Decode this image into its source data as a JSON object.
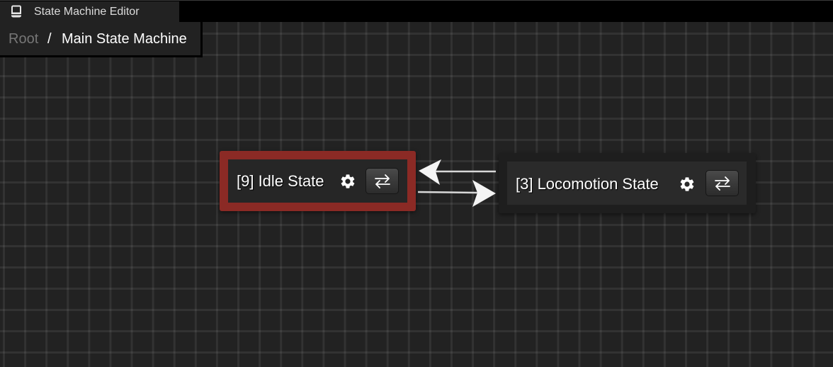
{
  "window": {
    "title": "State Machine Editor",
    "icon": "computer-icon"
  },
  "breadcrumb": {
    "root": "Root",
    "separator": "/",
    "current": "Main State Machine"
  },
  "nodes": [
    {
      "id": 9,
      "label": "[9] Idle State",
      "selected": true,
      "settings_icon": "gear-icon",
      "transition_icon": "swap-arrows-icon"
    },
    {
      "id": 3,
      "label": "[3] Locomotion State",
      "selected": false,
      "settings_icon": "gear-icon",
      "transition_icon": "swap-arrows-icon"
    }
  ],
  "transitions": [
    {
      "from": "[3] Locomotion State",
      "to": "[9] Idle State"
    },
    {
      "from": "[9] Idle State",
      "to": "[3] Locomotion State"
    }
  ],
  "colors": {
    "selected_border": "#8b2a25",
    "canvas_background": "#222222",
    "arrow": "#e8e8e8"
  }
}
